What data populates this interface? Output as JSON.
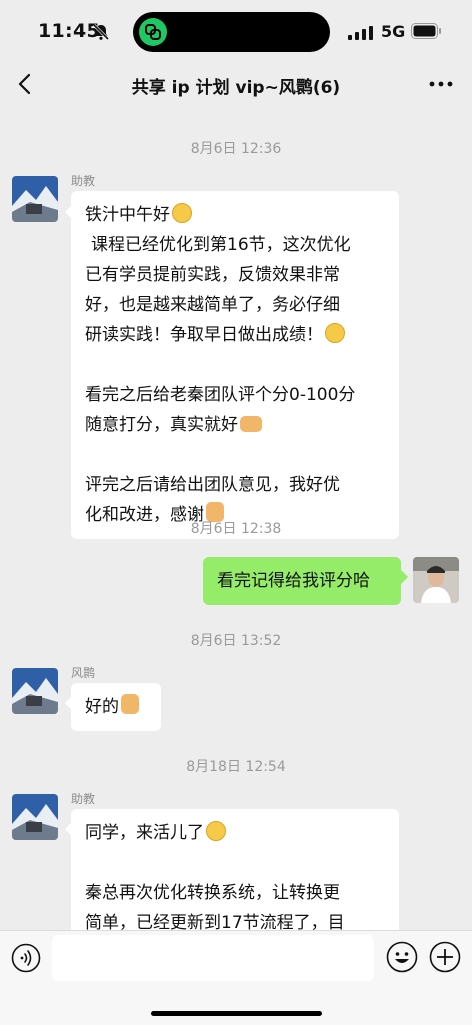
{
  "status_bar": {
    "time": "11:45",
    "network": "5G"
  },
  "header": {
    "title": "共享 ip 计划 vip~风鹮(6)"
  },
  "messages": [
    {
      "timestamp": "8月6日 12:36",
      "sender": "助教",
      "lines": [
        "铁汁中午好",
        " 课程已经优化到第16节，这次优化",
        "已有学员提前实践，反馈效果非常",
        "好，也是越来越简单了，务必仔细",
        "研读实践！争取早日做出成绩！",
        "",
        "看完之后给老秦团队评个分0-100分",
        "随意打分，真实就好",
        "",
        "评完之后请给出团队意见，我好优",
        "化和改进，感谢"
      ]
    },
    {
      "timestamp": "8月6日 12:38",
      "sender": "",
      "lines": [
        "看完记得给我评分哈"
      ]
    },
    {
      "timestamp": "8月6日 13:52",
      "sender": "风鹮",
      "lines": [
        "好的"
      ]
    },
    {
      "timestamp": "8月18日 12:54",
      "sender": "助教",
      "lines": [
        "同学，来活儿了",
        "",
        "秦总再次优化转换系统，让转换更",
        "简单，已经更新到17节流程了，目"
      ]
    }
  ],
  "input_bar": {
    "placeholder": ""
  },
  "icons": [
    "bell-slash-icon",
    "signal-icon",
    "battery-icon",
    "back-arrow-icon",
    "more-icon",
    "voice-icon",
    "emoji-icon",
    "plus-icon"
  ],
  "colors": {
    "background": "#ededed",
    "my_bubble": "#95ec69",
    "their_bubble": "#ffffff"
  }
}
